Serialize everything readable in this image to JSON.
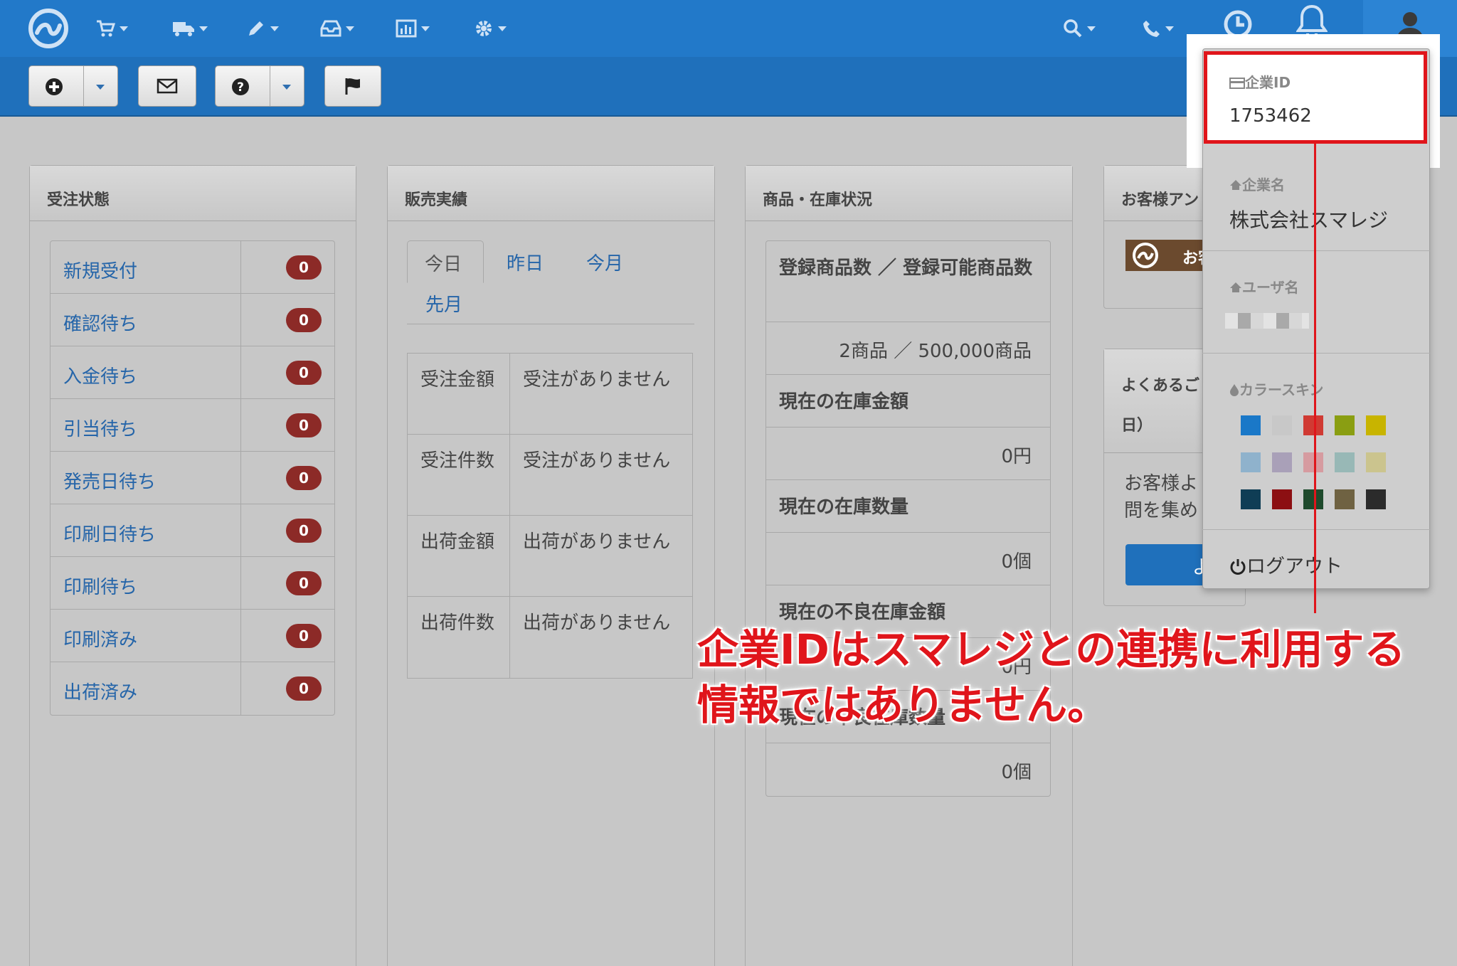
{
  "nav": {
    "icons": [
      "app-logo",
      "cart-icon",
      "truck-icon",
      "pencil-icon",
      "inbox-icon",
      "chart-icon",
      "gear-icon",
      "search-icon",
      "phone-icon",
      "clock-icon",
      "bell-icon",
      "user-icon"
    ]
  },
  "panels": {
    "order_status": {
      "title": "受注状態",
      "rows": [
        {
          "label": "新規受付",
          "count": "0"
        },
        {
          "label": "確認待ち",
          "count": "0"
        },
        {
          "label": "入金待ち",
          "count": "0"
        },
        {
          "label": "引当待ち",
          "count": "0"
        },
        {
          "label": "発売日待ち",
          "count": "0"
        },
        {
          "label": "印刷日待ち",
          "count": "0"
        },
        {
          "label": "印刷待ち",
          "count": "0"
        },
        {
          "label": "印刷済み",
          "count": "0"
        },
        {
          "label": "出荷済み",
          "count": "0"
        }
      ]
    },
    "sales": {
      "title": "販売実績",
      "tabs": [
        "今日",
        "昨日",
        "今月",
        "先月"
      ],
      "rows": [
        {
          "key": "受注金額",
          "value": "受注がありません"
        },
        {
          "key": "受注件数",
          "value": "受注がありません"
        },
        {
          "key": "出荷金額",
          "value": "出荷がありません"
        },
        {
          "key": "出荷件数",
          "value": "出荷がありません"
        }
      ]
    },
    "inventory": {
      "title": "商品・在庫状況",
      "rows": [
        {
          "heading": "登録商品数 ／ 登録可能商品数",
          "value": "2商品 ／ 500,000商品"
        },
        {
          "heading": "現在の在庫金額",
          "value": "0円"
        },
        {
          "heading": "現在の在庫数量",
          "value": "0個"
        },
        {
          "heading": "現在の不良在庫金額",
          "value": "0円"
        },
        {
          "heading": "現在の不良在庫数量",
          "value": "0個"
        }
      ]
    },
    "survey": {
      "title": "お客様アン",
      "banner": "お客"
    },
    "faq": {
      "title": "よくあるご",
      "subtitle": "日）",
      "body1": "お客様よ",
      "body2": "問を集め",
      "button": "よ"
    }
  },
  "dropdown": {
    "company_id_label": "企業ID",
    "company_id": "1753462",
    "company_name_label": "企業名",
    "company_name": "株式会社スマレジ",
    "user_name_label": "ユーザ名",
    "color_skin_label": "カラースキン",
    "swatches": [
      "#1a78c8",
      "#c8c8c8",
      "#d03a33",
      "#8a9e12",
      "#c8b400",
      "#8fb2cc",
      "#a9a0b8",
      "#d69ba0",
      "#98b8b6",
      "#cbc48e",
      "#0f3d55",
      "#8c0f12",
      "#1e4a2c",
      "#6f6242",
      "#2b2b2b"
    ],
    "logout": "ログアウト"
  },
  "annotation": {
    "line1": "企業IDはスマレジとの連携に利用する",
    "line2": "情報ではありません。"
  }
}
